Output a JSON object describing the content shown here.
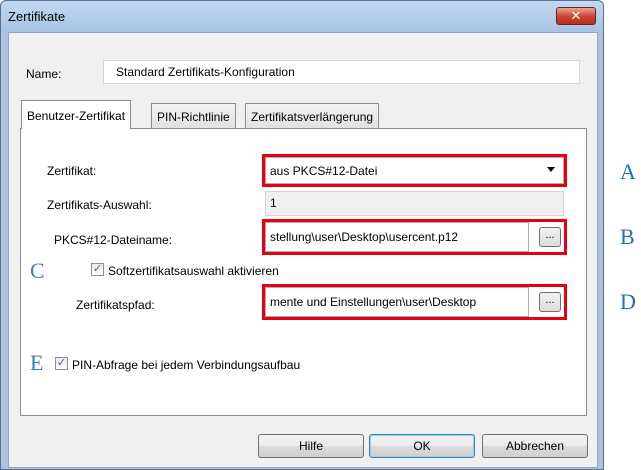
{
  "window": {
    "title": "Zertifikate",
    "close_glyph": "✕"
  },
  "name": {
    "label": "Name:",
    "value": "Standard Zertifikats-Konfiguration"
  },
  "tabs": [
    {
      "label": "Benutzer-Zertifikat",
      "active": true
    },
    {
      "label": "PIN-Richtlinie",
      "active": false
    },
    {
      "label": "Zertifikatsverlängerung",
      "active": false
    }
  ],
  "certificate": {
    "label": "Zertifikat:",
    "selected": "aus PKCS#12-Datei"
  },
  "certificate_selection": {
    "label": "Zertifikats-Auswahl:",
    "value": "1"
  },
  "pkcs12_filename": {
    "label": "PKCS#12-Dateiname:",
    "value": "stellung\\user\\Desktop\\usercent.p12",
    "browse_label": "..."
  },
  "soft_certificate": {
    "label": "Softzertifikatsauswahl aktivieren",
    "checked": true
  },
  "certificate_path": {
    "label": "Zertifikatspfad:",
    "value": "mente und Einstellungen\\user\\Desktop",
    "browse_label": "..."
  },
  "pin_query": {
    "label": "PIN-Abfrage bei jedem Verbindungsaufbau",
    "checked": true
  },
  "buttons": {
    "help": "Hilfe",
    "ok": "OK",
    "cancel": "Abbrechen"
  },
  "markers": {
    "a": "A",
    "b": "B",
    "c": "C",
    "d": "D",
    "e": "E"
  },
  "checkbox_glyph": "✓",
  "colors": {
    "highlight_frame": "#e60012",
    "marker": "#1f6fc4",
    "window_frame": "#a9c3e0"
  }
}
